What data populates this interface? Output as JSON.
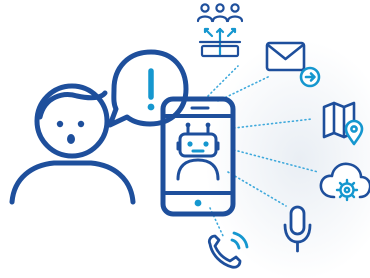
{
  "scene": {
    "subject": "chatbot-smartphone-illustration",
    "colors": {
      "primary": "#1e4f9c",
      "accent": "#1597cf",
      "connector": "#3fa9dc",
      "glow": "#e9eef4",
      "background": "#ffffff"
    },
    "figures": {
      "person": {
        "expression": "surprised"
      },
      "speech_bubble": {
        "symbol": "!"
      },
      "phone": {
        "screen_content": "robot-chatbot"
      }
    },
    "channel_icons": [
      {
        "name": "users-network-icon"
      },
      {
        "name": "email-forward-icon"
      },
      {
        "name": "map-location-icon"
      },
      {
        "name": "cloud-settings-icon"
      },
      {
        "name": "microphone-icon"
      },
      {
        "name": "phone-call-icon"
      }
    ]
  }
}
